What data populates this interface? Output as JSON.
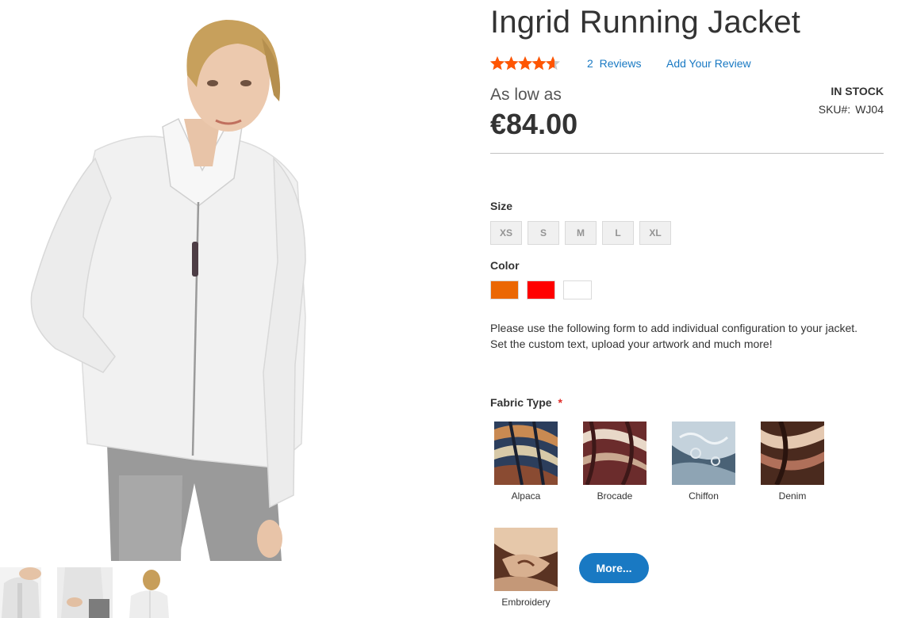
{
  "product": {
    "title": "Ingrid Running Jacket",
    "rating_fraction": 0.9,
    "reviews_count": "2",
    "reviews_label": "Reviews",
    "add_review_label": "Add Your Review",
    "price_prefix": "As low as",
    "price": "€84.00",
    "stock_status": "IN STOCK",
    "sku_label": "SKU#:",
    "sku_value": "WJ04"
  },
  "options": {
    "size_label": "Size",
    "sizes": [
      "XS",
      "S",
      "M",
      "L",
      "XL"
    ],
    "color_label": "Color",
    "colors": [
      {
        "name": "Orange",
        "hex": "#eb6703"
      },
      {
        "name": "Red",
        "hex": "#ff0000"
      },
      {
        "name": "White",
        "hex": "#ffffff"
      }
    ]
  },
  "configuration": {
    "note_line1": "Please use the following form to add individual configuration to your jacket.",
    "note_line2": "Set the custom text, upload your artwork and much more!",
    "fabric_label": "Fabric Type",
    "required_mark": "*",
    "fabrics": [
      "Alpaca",
      "Brocade",
      "Chiffon",
      "Denim",
      "Embroidery"
    ],
    "more_label": "More..."
  },
  "colors": {
    "link": "#1979c3",
    "star": "#ff5501",
    "button": "#1979c3",
    "required": "#e02b27"
  }
}
